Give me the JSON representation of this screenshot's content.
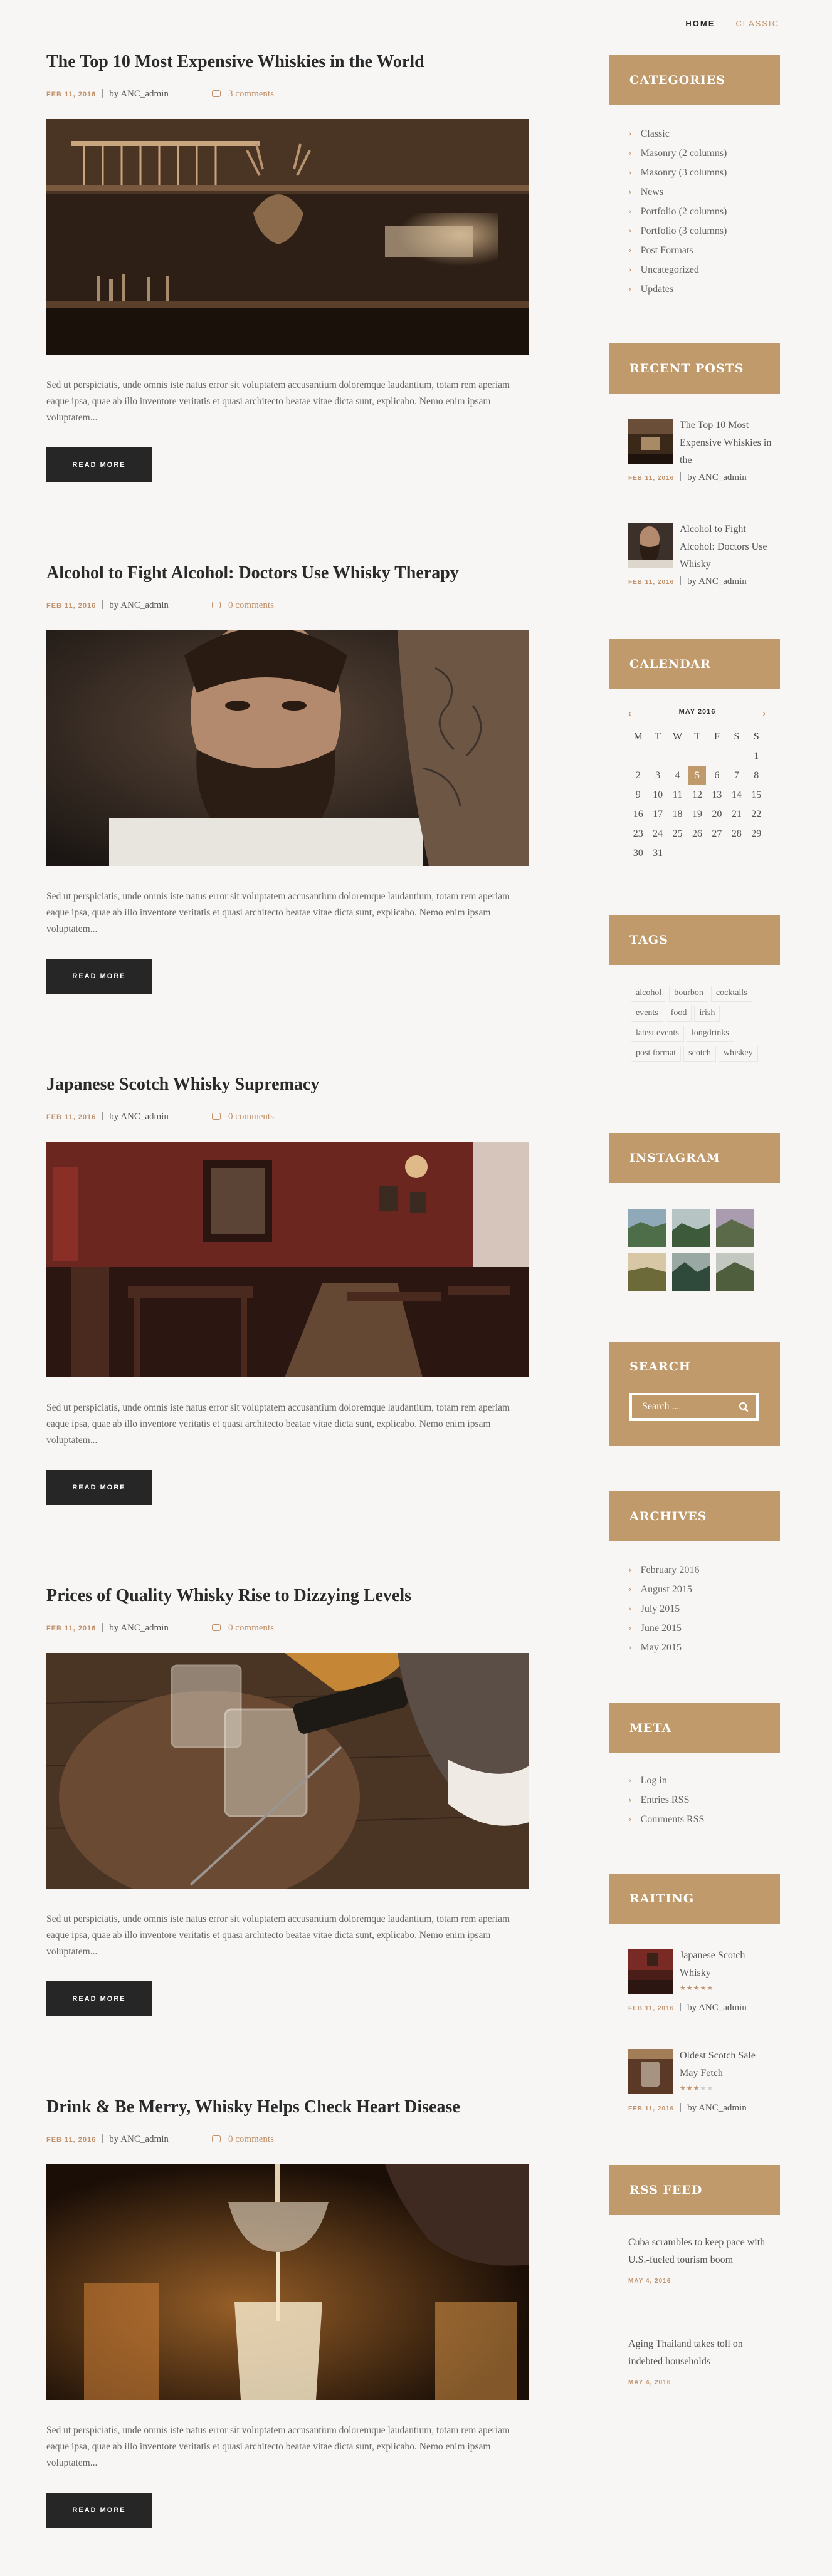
{
  "breadcrumb": {
    "home": "Home",
    "current": "Classic"
  },
  "posts": [
    {
      "title": "The Top 10 Most Expensive Whiskies in the World",
      "date": "FEB 11, 2016",
      "author": "by ANC_admin",
      "comments": "3 comments",
      "image": "bar-interior-with-stag-head",
      "excerpt": "Sed ut perspiciatis, unde omnis iste natus error sit voluptatem accusantium doloremque laudantium, totam rem aperiam eaque ipsa, quae ab illo inventore veritatis et quasi architecto beatae vitae dicta sunt, explicabo. Nemo enim ipsam voluptatem...",
      "button": "Read more"
    },
    {
      "title": "Alcohol to Fight Alcohol: Doctors Use Whisky Therapy",
      "date": "FEB 11, 2016",
      "author": "by ANC_admin",
      "comments": "0 comments",
      "image": "bearded-tattooed-man",
      "excerpt": "Sed ut perspiciatis, unde omnis iste natus error sit voluptatem accusantium doloremque laudantium, totam rem aperiam eaque ipsa, quae ab illo inventore veritatis et quasi architecto beatae vitae dicta sunt, explicabo. Nemo enim ipsam voluptatem...",
      "button": "Read more"
    },
    {
      "title": "Japanese Scotch Whisky Supremacy",
      "date": "FEB 11, 2016",
      "author": "by ANC_admin",
      "comments": "0 comments",
      "image": "red-pub-dining-room",
      "excerpt": "Sed ut perspiciatis, unde omnis iste natus error sit voluptatem accusantium doloremque laudantium, totam rem aperiam eaque ipsa, quae ab illo inventore veritatis et quasi architecto beatae vitae dicta sunt, explicabo. Nemo enim ipsam voluptatem...",
      "button": "Read more"
    },
    {
      "title": "Prices of Quality Whisky Rise to Dizzying Levels",
      "date": "FEB 11, 2016",
      "author": "by ANC_admin",
      "comments": "0 comments",
      "image": "pouring-whisky-into-glasses",
      "excerpt": "Sed ut perspiciatis, unde omnis iste natus error sit voluptatem accusantium doloremque laudantium, totam rem aperiam eaque ipsa, quae ab illo inventore veritatis et quasi architecto beatae vitae dicta sunt, explicabo. Nemo enim ipsam voluptatem...",
      "button": "Read more"
    },
    {
      "title": "Drink & Be Merry, Whisky Helps Check Heart Disease",
      "date": "FEB 11, 2016",
      "author": "by ANC_admin",
      "comments": "0 comments",
      "image": "bartender-pouring-cocktail",
      "excerpt": "Sed ut perspiciatis, unde omnis iste natus error sit voluptatem accusantium doloremque laudantium, totam rem aperiam eaque ipsa, quae ab illo inventore veritatis et quasi architecto beatae vitae dicta sunt, explicabo. Nemo enim ipsam voluptatem...",
      "button": "Read more"
    }
  ],
  "sidebar": {
    "categories": {
      "title": "Categories",
      "items": [
        "Classic",
        "Masonry (2 columns)",
        "Masonry (3 columns)",
        "News",
        "Portfolio (2 columns)",
        "Portfolio (3 columns)",
        "Post Formats",
        "Uncategorized",
        "Updates"
      ]
    },
    "recent_posts": {
      "title": "Recent Posts",
      "items": [
        {
          "title": "The Top 10 Most Expensive Whiskies in the",
          "date": "FEB 11, 2016",
          "author": "by ANC_admin"
        },
        {
          "title": "Alcohol to Fight Alcohol: Doctors Use Whisky",
          "date": "FEB 11, 2016",
          "author": "by ANC_admin"
        }
      ]
    },
    "calendar": {
      "title": "Calendar",
      "month": "MAY 2016",
      "prev": "‹",
      "next": "›",
      "weekdays": [
        "M",
        "T",
        "W",
        "T",
        "F",
        "S",
        "S"
      ],
      "today": 5,
      "weeks": [
        [
          "",
          "",
          "",
          "",
          "",
          "",
          "1"
        ],
        [
          "2",
          "3",
          "4",
          "5",
          "6",
          "7",
          "8"
        ],
        [
          "9",
          "10",
          "11",
          "12",
          "13",
          "14",
          "15"
        ],
        [
          "16",
          "17",
          "18",
          "19",
          "20",
          "21",
          "22"
        ],
        [
          "23",
          "24",
          "25",
          "26",
          "27",
          "28",
          "29"
        ],
        [
          "30",
          "31",
          "",
          "",
          "",
          "",
          ""
        ]
      ]
    },
    "tags": {
      "title": "Tags",
      "items": [
        "alcohol",
        "bourbon",
        "cocktails",
        "events",
        "food",
        "irish",
        "latest events",
        "longdrinks",
        "post format",
        "scotch",
        "whiskey"
      ]
    },
    "instagram": {
      "title": "Instagram"
    },
    "search": {
      "title": "Search",
      "placeholder": "Search ..."
    },
    "archives": {
      "title": "Archives",
      "items": [
        "February 2016",
        "August 2015",
        "July 2015",
        "June 2015",
        "May 2015"
      ]
    },
    "meta": {
      "title": "Meta",
      "items": [
        "Log in",
        "Entries RSS",
        "Comments RSS"
      ]
    },
    "rating": {
      "title": "Raiting",
      "items": [
        {
          "title": "Japanese Scotch Whisky",
          "stars": 5,
          "date": "FEB 11, 2016",
          "author": "by ANC_admin"
        },
        {
          "title": "Oldest Scotch Sale May Fetch",
          "stars": 3,
          "date": "FEB 11, 2016",
          "author": "by ANC_admin"
        }
      ]
    },
    "rss": {
      "title": "RSS Feed",
      "items": [
        {
          "title": "Cuba scrambles to keep pace with U.S.-fueled tourism boom",
          "date": "MAY 4, 2016"
        },
        {
          "title": "Aging Thailand takes toll on indebted households",
          "date": "MAY 4, 2016"
        }
      ]
    }
  },
  "colors": {
    "accent": "#c19a6b",
    "button": "#262626",
    "background": "#f7f6f5"
  }
}
